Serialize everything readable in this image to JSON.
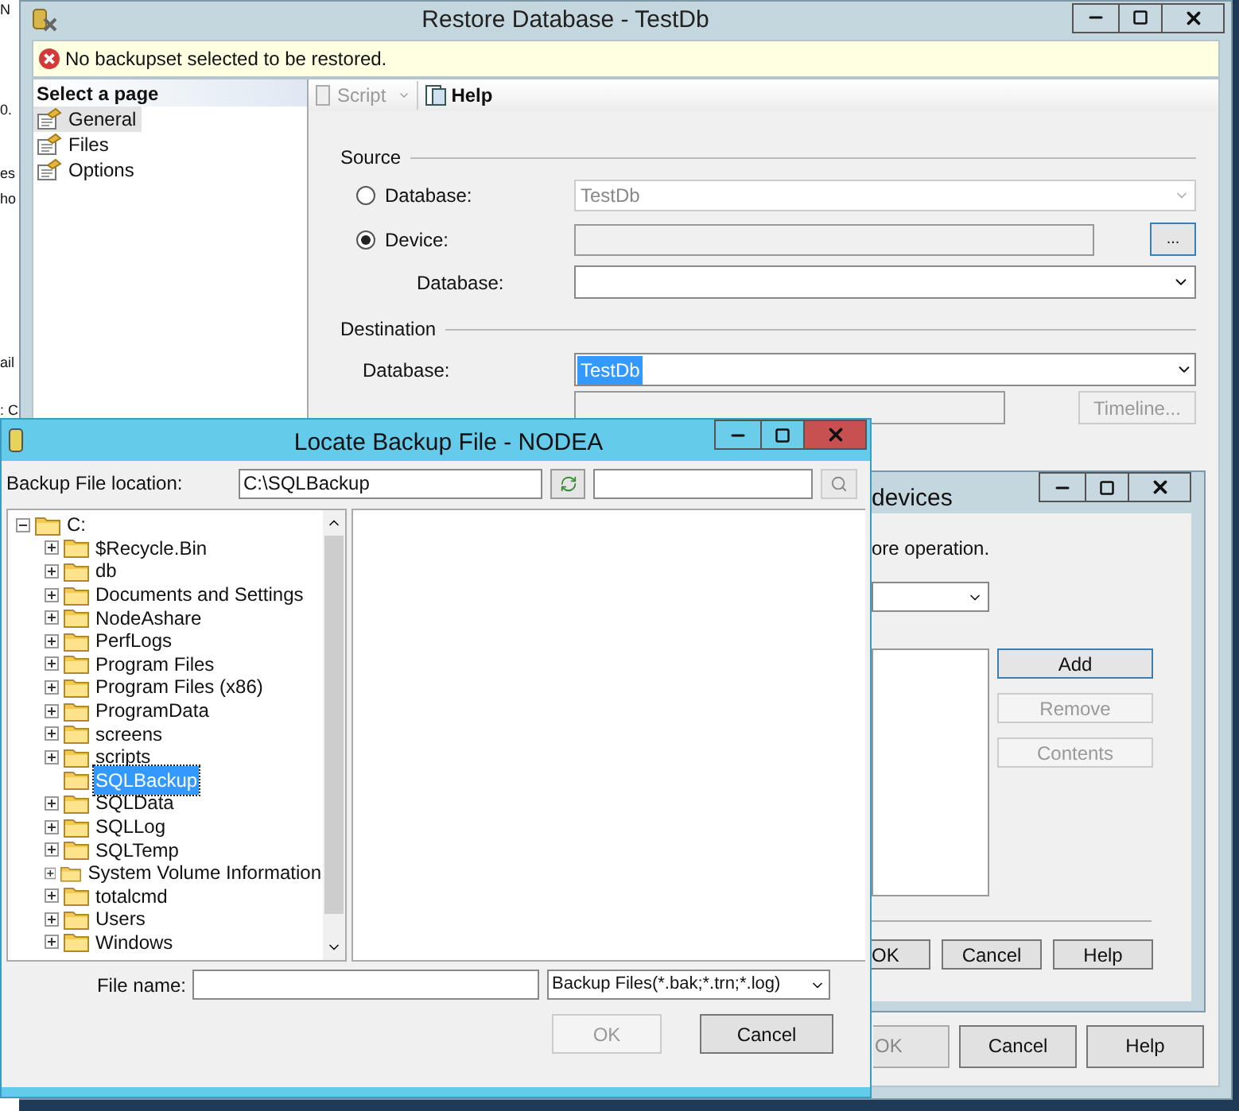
{
  "background_fragments": [
    "N",
    "0.",
    "es",
    "ho",
    "ail",
    ": C"
  ],
  "restore_window": {
    "title": "Restore Database - TestDb",
    "message": "No backupset selected to be restored.",
    "page_header": "Select a page",
    "pages": [
      {
        "label": "General",
        "selected": true
      },
      {
        "label": "Files",
        "selected": false
      },
      {
        "label": "Options",
        "selected": false
      }
    ],
    "toolbar": [
      {
        "kind": "dropdown",
        "label": "Script",
        "disabled": true
      },
      {
        "kind": "button",
        "label": "Help",
        "disabled": false
      }
    ],
    "source": {
      "heading": "Source",
      "options": [
        {
          "label": "Database:",
          "selected": false,
          "value": "TestDb"
        },
        {
          "label": "Device:",
          "selected": true
        }
      ],
      "browse_button": "...",
      "database_label": "Database:"
    },
    "destination": {
      "heading": "Destination",
      "database_label": "Database:",
      "database_value": "TestDb",
      "timeline_button": "Timeline..."
    },
    "buttons": [
      "OK",
      "Cancel",
      "Help"
    ]
  },
  "devices_window": {
    "title": "devices",
    "text": "ore operation.",
    "side_buttons": [
      {
        "label": "Add",
        "disabled": false
      },
      {
        "label": "Remove",
        "disabled": true
      },
      {
        "label": "Contents",
        "disabled": true
      }
    ],
    "buttons": [
      "OK",
      "Cancel",
      "Help"
    ]
  },
  "locate_window": {
    "title": "Locate Backup File - NODEA",
    "location_label": "Backup File location:",
    "location_value": "C:\\SQLBackup",
    "file_name_label": "File name:",
    "file_type": "Backup Files(*.bak;*.trn;*.log)",
    "tree": [
      {
        "label": "C:",
        "expanded": true,
        "selected": false,
        "children": [
          {
            "label": "$Recycle.Bin",
            "expandable": true,
            "selected": false
          },
          {
            "label": "db",
            "expandable": true,
            "selected": false
          },
          {
            "label": "Documents and Settings",
            "expandable": true,
            "selected": false
          },
          {
            "label": "NodeAshare",
            "expandable": true,
            "selected": false
          },
          {
            "label": "PerfLogs",
            "expandable": true,
            "selected": false
          },
          {
            "label": "Program Files",
            "expandable": true,
            "selected": false
          },
          {
            "label": "Program Files (x86)",
            "expandable": true,
            "selected": false
          },
          {
            "label": "ProgramData",
            "expandable": true,
            "selected": false
          },
          {
            "label": "screens",
            "expandable": true,
            "selected": false
          },
          {
            "label": "scripts",
            "expandable": true,
            "selected": false
          },
          {
            "label": "SQLBackup",
            "expandable": false,
            "selected": true
          },
          {
            "label": "SQLData",
            "expandable": true,
            "selected": false
          },
          {
            "label": "SQLLog",
            "expandable": true,
            "selected": false
          },
          {
            "label": "SQLTemp",
            "expandable": true,
            "selected": false
          },
          {
            "label": "System Volume Information",
            "expandable": true,
            "selected": false
          },
          {
            "label": "totalcmd",
            "expandable": true,
            "selected": false
          },
          {
            "label": "Users",
            "expandable": true,
            "selected": false
          },
          {
            "label": "Windows",
            "expandable": true,
            "selected": false
          }
        ]
      }
    ],
    "buttons": [
      {
        "label": "OK",
        "disabled": true
      },
      {
        "label": "Cancel",
        "disabled": false
      }
    ]
  }
}
